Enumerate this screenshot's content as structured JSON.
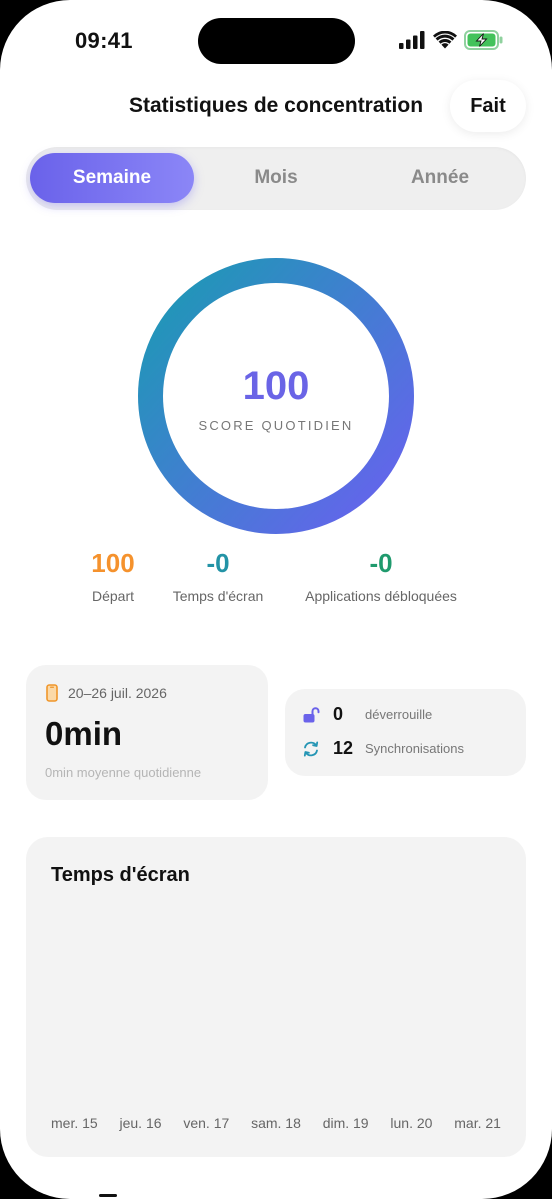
{
  "status_bar": {
    "time": "09:41"
  },
  "header": {
    "title": "Statistiques de concentration",
    "done_label": "Fait"
  },
  "period_tabs": [
    {
      "label": "Semaine",
      "active": true
    },
    {
      "label": "Mois",
      "active": false
    },
    {
      "label": "Année",
      "active": false
    }
  ],
  "daily_score": {
    "value": "100",
    "label": "SCORE QUOTIDIEN",
    "progress": 1.0
  },
  "stats": [
    {
      "value": "100",
      "label": "Départ",
      "color": "#f5922d"
    },
    {
      "value": "-0",
      "label": "Temps d'écran",
      "color": "#2393a6"
    },
    {
      "value": "-0",
      "label": "Applications débloquées",
      "color": "#1f9a6d"
    }
  ],
  "week": {
    "icon": "phone-icon",
    "range": "20–26 juil. 2026",
    "total": "0min",
    "average": "0min moyenne quotidienne"
  },
  "activity": {
    "unlocks": {
      "icon": "unlock-icon",
      "value": "0",
      "label": "déverrouille"
    },
    "syncs": {
      "icon": "sync-icon",
      "value": "12",
      "label": "Synchronisations"
    }
  },
  "screen_time_chart": {
    "title": "Temps d'écran",
    "days": [
      "mer. 15",
      "jeu. 16",
      "ven. 17",
      "sam. 18",
      "dim. 19",
      "lun. 20",
      "mar. 21"
    ]
  },
  "colors": {
    "accent": "#6a62ea",
    "ring_start": "#6266ea",
    "ring_end": "#2295b9"
  }
}
